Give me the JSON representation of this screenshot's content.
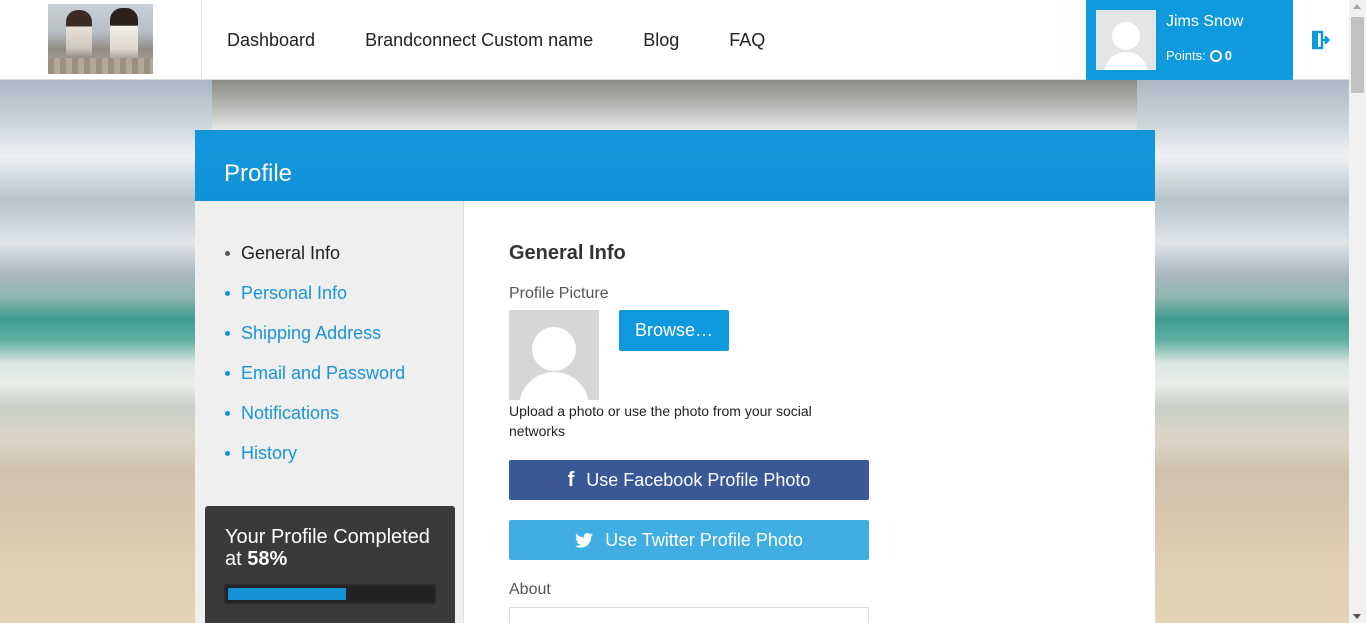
{
  "nav": {
    "items": [
      "Dashboard",
      "Brandconnect Custom name",
      "Blog",
      "FAQ"
    ]
  },
  "user": {
    "name": "Jims Snow",
    "points_label": "Points:",
    "points_value": "0"
  },
  "panel": {
    "title": "Profile"
  },
  "sidebar": {
    "items": [
      {
        "label": "General Info",
        "active": true
      },
      {
        "label": "Personal Info",
        "active": false
      },
      {
        "label": "Shipping Address",
        "active": false
      },
      {
        "label": "Email and Password",
        "active": false
      },
      {
        "label": "Notifications",
        "active": false
      },
      {
        "label": "History",
        "active": false
      }
    ],
    "progress": {
      "text": "Your Profile Completed at",
      "percent_label": "58%",
      "value": 0.58
    }
  },
  "general": {
    "title": "General Info",
    "profile_picture_label": "Profile Picture",
    "browse_label": "Browse…",
    "upload_text": "Upload a photo or use the photo from your social networks",
    "facebook_label": "Use Facebook Profile Photo",
    "twitter_label": "Use Twitter Profile Photo",
    "about_label": "About"
  },
  "colors": {
    "accent": "#0f99de",
    "facebook": "#3a5898",
    "twitter": "#40aee3"
  }
}
